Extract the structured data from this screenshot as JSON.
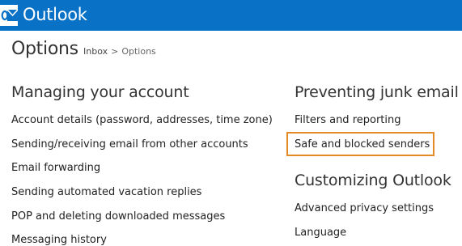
{
  "header": {
    "app_name": "Outlook",
    "brand_color": "#0a72c6",
    "logo_icon": "outlook-logo-icon"
  },
  "page": {
    "title": "Options",
    "breadcrumb": {
      "inbox": "Inbox",
      "separator": ">",
      "current": "Options"
    }
  },
  "sections": {
    "managing": {
      "title": "Managing your account",
      "links": [
        "Account details (password, addresses, time zone)",
        "Sending/receiving email from other accounts",
        "Email forwarding",
        "Sending automated vacation replies",
        "POP and deleting downloaded messages",
        "Messaging history"
      ]
    },
    "junk": {
      "title": "Preventing junk email",
      "links": [
        "Filters and reporting",
        "Safe and blocked senders"
      ]
    },
    "customizing": {
      "title": "Customizing Outlook",
      "links": [
        "Advanced privacy settings",
        "Language"
      ]
    }
  },
  "highlight_color": "#e48a24"
}
